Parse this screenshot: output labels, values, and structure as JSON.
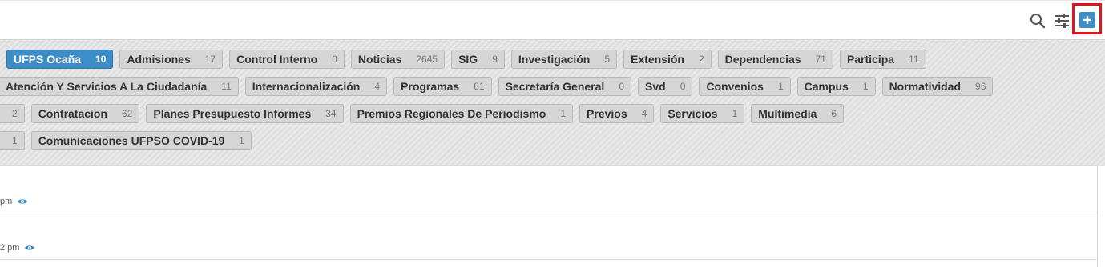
{
  "toolbar": {
    "search_icon": "search-icon",
    "filter_icon": "sliders-icon",
    "add_icon": "plus-icon",
    "add_label": "+"
  },
  "colors": {
    "accent": "#3d8ec8",
    "highlight": "#e0151b",
    "tag_bg": "#d6d6d6"
  },
  "tags": [
    [
      {
        "label": "UFPS Ocaña",
        "count": "10",
        "active": true
      },
      {
        "label": "Admisiones",
        "count": "17"
      },
      {
        "label": "Control Interno",
        "count": "0"
      },
      {
        "label": "Noticias",
        "count": "2645"
      },
      {
        "label": "SIG",
        "count": "9"
      },
      {
        "label": "Investigación",
        "count": "5"
      },
      {
        "label": "Extensión",
        "count": "2"
      },
      {
        "label": "Dependencias",
        "count": "71"
      },
      {
        "label": "Participa",
        "count": "11"
      }
    ],
    [
      {
        "label": "Atención Y Servicios A La Ciudadanía",
        "count": "11"
      },
      {
        "label": "Internacionalización",
        "count": "4"
      },
      {
        "label": "Programas",
        "count": "81"
      },
      {
        "label": "Secretaría General",
        "count": "0"
      },
      {
        "label": "Svd",
        "count": "0"
      },
      {
        "label": "Convenios",
        "count": "1"
      },
      {
        "label": "Campus",
        "count": "1"
      },
      {
        "label": "Normatividad",
        "count": "96"
      }
    ],
    [
      {
        "label": "",
        "count": "2"
      },
      {
        "label": "Contratacion",
        "count": "62"
      },
      {
        "label": "Planes Presupuesto Informes",
        "count": "34"
      },
      {
        "label": "Premios Regionales De Periodismo",
        "count": "1"
      },
      {
        "label": "Previos",
        "count": "4"
      },
      {
        "label": "Servicios",
        "count": "1"
      },
      {
        "label": "Multimedia",
        "count": "6"
      }
    ],
    [
      {
        "label": "",
        "count": "1"
      },
      {
        "label": "Comunicaciones UFPSO COVID-19",
        "count": "1"
      }
    ]
  ],
  "items": [
    {
      "time": "pm"
    },
    {
      "time": "2 pm"
    }
  ]
}
